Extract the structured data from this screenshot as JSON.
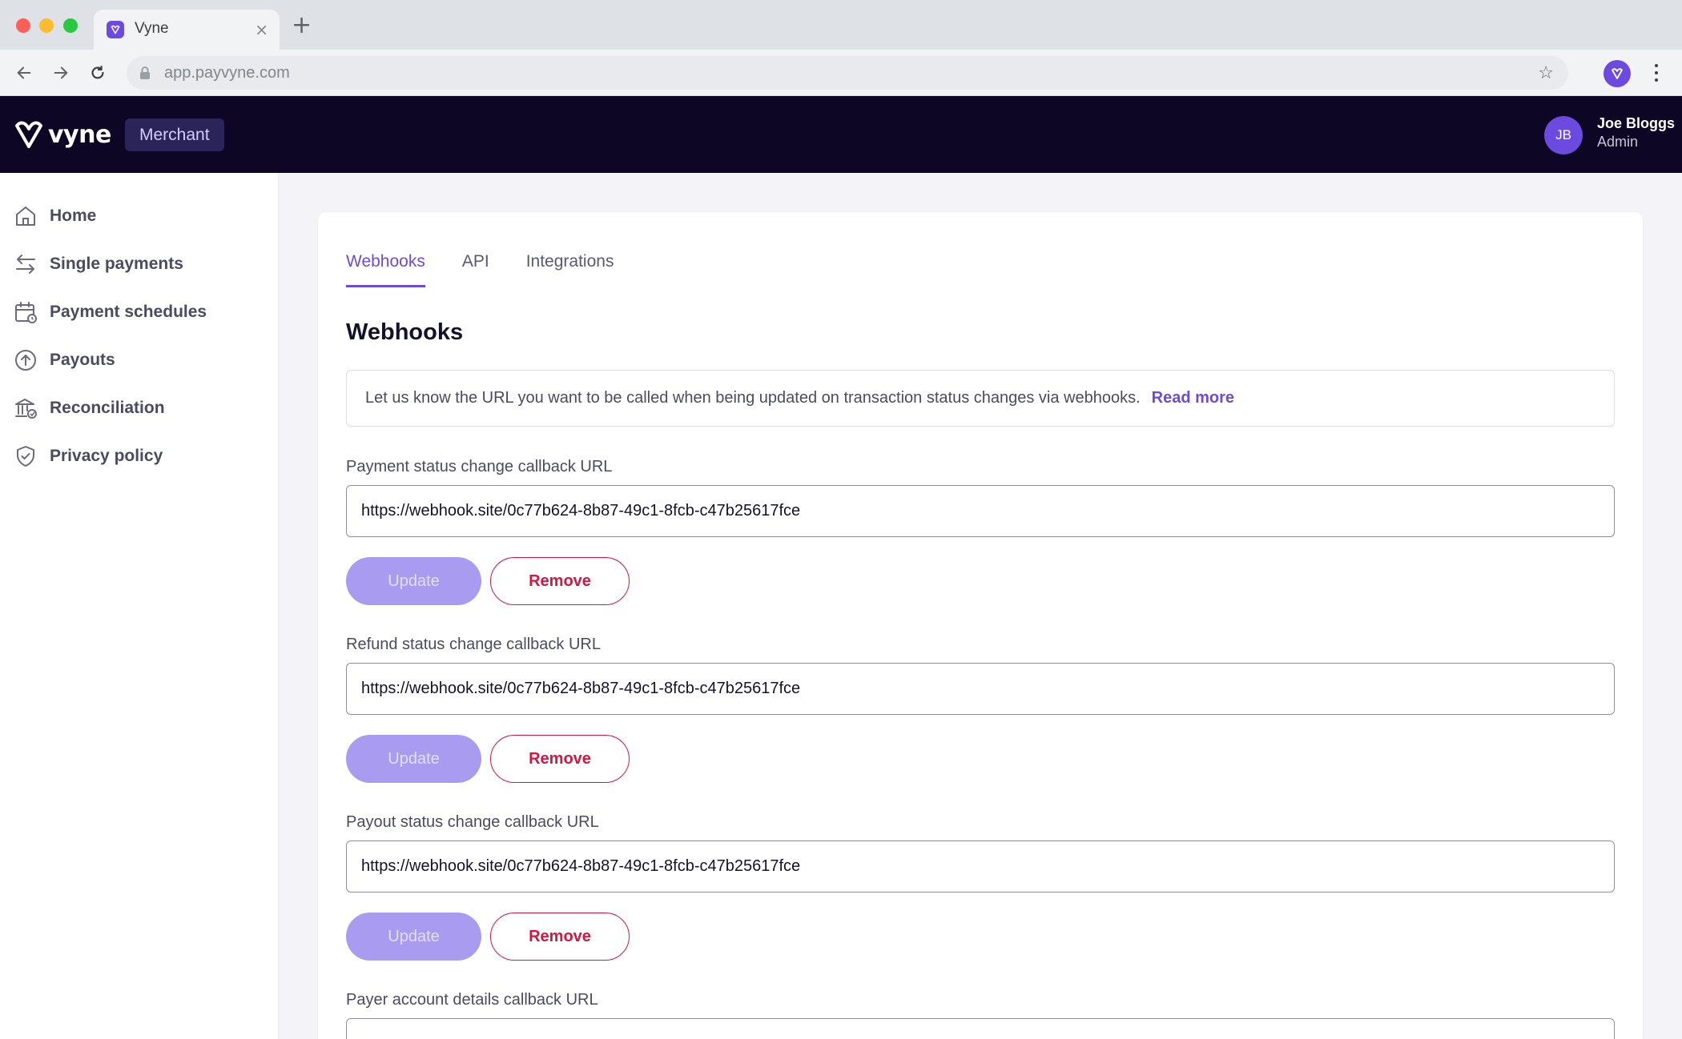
{
  "browser": {
    "tab_title": "Vyne",
    "url": "app.payvyne.com"
  },
  "header": {
    "logo_text": "vyne",
    "badge": "Merchant",
    "user": {
      "initials": "JB",
      "name": "Joe Bloggs",
      "role": "Admin"
    }
  },
  "sidebar": {
    "items": [
      {
        "label": "Home",
        "icon": "home-icon"
      },
      {
        "label": "Single payments",
        "icon": "arrows-swap-icon"
      },
      {
        "label": "Payment schedules",
        "icon": "calendar-icon"
      },
      {
        "label": "Payouts",
        "icon": "arrow-up-circle-icon"
      },
      {
        "label": "Reconciliation",
        "icon": "bank-icon"
      },
      {
        "label": "Privacy policy",
        "icon": "shield-check-icon"
      }
    ]
  },
  "main": {
    "tabs": [
      {
        "label": "Webhooks",
        "active": true
      },
      {
        "label": "API",
        "active": false
      },
      {
        "label": "Integrations",
        "active": false
      }
    ],
    "title": "Webhooks",
    "info": {
      "text": "Let us know the URL you want to be called when being updated on transaction status changes via webhooks.",
      "link": "Read more"
    },
    "fields": [
      {
        "label": "Payment status change callback URL",
        "value": "https://webhook.site/0c77b624-8b87-49c1-8fcb-c47b25617fce"
      },
      {
        "label": "Refund status change callback URL",
        "value": "https://webhook.site/0c77b624-8b87-49c1-8fcb-c47b25617fce"
      },
      {
        "label": "Payout status change callback URL",
        "value": "https://webhook.site/0c77b624-8b87-49c1-8fcb-c47b25617fce"
      },
      {
        "label": "Payer account details callback URL",
        "value": ""
      }
    ],
    "buttons": {
      "update": "Update",
      "remove": "Remove"
    }
  },
  "colors": {
    "brand": "#6c4ae0",
    "header_bg": "#0d0624",
    "danger": "#d8143f",
    "disabled_button": "#a99bf0"
  }
}
